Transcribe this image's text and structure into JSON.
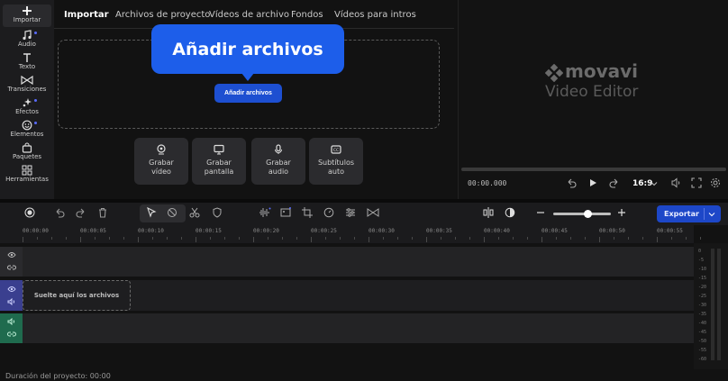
{
  "sidebar": {
    "items": [
      {
        "label": "Importar",
        "icon": "plus-icon",
        "active": true
      },
      {
        "label": "Audio",
        "icon": "music-note-icon"
      },
      {
        "label": "Texto",
        "icon": "text-t-icon"
      },
      {
        "label": "Transiciones",
        "icon": "transition-bowtie-icon"
      },
      {
        "label": "Efectos",
        "icon": "sparkle-icon"
      },
      {
        "label": "Elementos",
        "icon": "smiley-icon"
      },
      {
        "label": "Paquetes",
        "icon": "bag-icon"
      },
      {
        "label": "Herramientas",
        "icon": "grid-icon"
      }
    ]
  },
  "tabs": [
    "Importar",
    "Archivos de proyecto",
    "Vídeos de archivo",
    "Fondos",
    "Vídeos para intros"
  ],
  "import": {
    "callout": "Añadir archivos",
    "add_button": "Añadir archivos",
    "actions": [
      {
        "line1": "Grabar",
        "line2": "vídeo",
        "icon": "webcam-icon"
      },
      {
        "line1": "Grabar",
        "line2": "pantalla",
        "icon": "monitor-icon"
      },
      {
        "line1": "Grabar",
        "line2": "audio",
        "icon": "microphone-icon"
      },
      {
        "line1": "Subtítulos",
        "line2": "auto",
        "icon": "cc-icon"
      }
    ]
  },
  "preview": {
    "brand": "movavi",
    "product": "Video Editor",
    "timecode": "00:00.000",
    "aspect_ratio": "16:9"
  },
  "toolbar": {
    "export_label": "Exportar"
  },
  "ruler": {
    "labels": [
      "00:00:00",
      "00:00:05",
      "00:00:10",
      "00:00:15",
      "00:00:20",
      "00:00:25",
      "00:00:30",
      "00:00:35",
      "00:00:40",
      "00:00:45",
      "00:00:50",
      "00:00:55"
    ]
  },
  "timeline": {
    "drop_hint": "Suelte aquí los archivos"
  },
  "meter": {
    "labels": [
      "0",
      "-5",
      "-10",
      "-15",
      "-20",
      "-25",
      "-30",
      "-35",
      "-40",
      "-45",
      "-50",
      "-55",
      "-60"
    ]
  },
  "status": {
    "duration": "Duración del proyecto: 00:00"
  },
  "colors": {
    "accent": "#1d5eea",
    "video_track": "#3a3f8f",
    "audio_track": "#1f6b4e"
  }
}
